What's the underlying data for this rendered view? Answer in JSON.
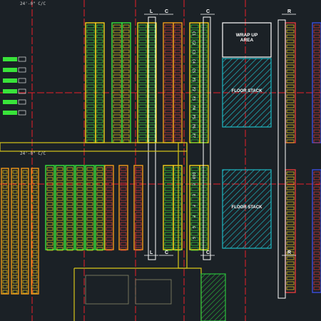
{
  "drawing": {
    "areas": {
      "wrap_up_title": "WRAP UP",
      "wrap_up_sub": "AREA",
      "floor_stack_top": "FLOOR STACK",
      "floor_stack_bottom": "FLOOR STACK"
    },
    "aisle_tags": {
      "top": [
        "L",
        "C",
        "C",
        "R"
      ],
      "bottom": [
        "L",
        "C",
        "C",
        "R"
      ]
    },
    "rack_codes_column_c": [
      "C1",
      "C2",
      "C3",
      "C4",
      "C5",
      "F1",
      "F2",
      "F3",
      "F4",
      "F5",
      "F6",
      "F7"
    ],
    "rack_codes_column_d": [
      "D10",
      "E",
      "E",
      "F",
      "F",
      "G",
      "G"
    ],
    "annotations": {
      "top_left": "24'-0\" C/C",
      "mid_left": "24'-0\" C/C"
    }
  },
  "colors": {
    "background": "#1b2126",
    "grid_red": "#e8202a",
    "rack_yellow": "#f2d21a",
    "rack_green": "#39e43a",
    "rack_orange": "#f29a1a",
    "rack_red": "#e23a3a",
    "rack_blue": "#3b4fe0",
    "hatch_cyan": "#1fb8c4",
    "outline_white": "#ffffff",
    "outline_yellow": "#d8c51a",
    "zone_green": "#2bbf3c"
  }
}
